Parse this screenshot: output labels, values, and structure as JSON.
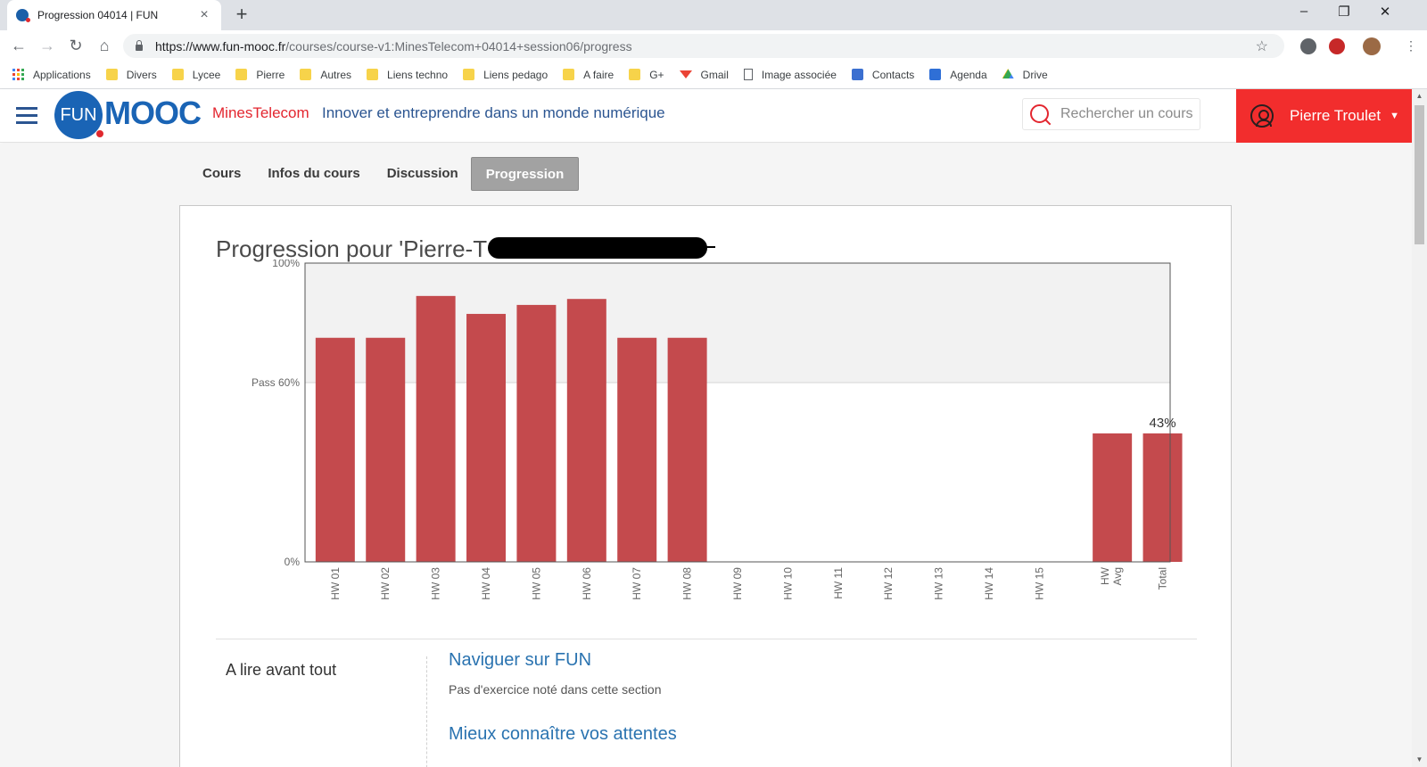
{
  "browser": {
    "tab_title": "Progression 04014 | FUN",
    "tab_close": "×",
    "new_tab": "+",
    "url_host": "https://www.fun-mooc.fr",
    "url_path": "/courses/course-v1:MinesTelecom+04014+session06/progress",
    "win_minimize": "–",
    "win_restore": "❐",
    "win_close": "✕",
    "nav_back": "←",
    "nav_forward": "→",
    "nav_reload": "↻",
    "nav_home": "⌂",
    "star": "☆",
    "bookmarks": [
      {
        "label": "Applications",
        "icon": "apps-grid-icon"
      },
      {
        "label": "Divers",
        "icon": "folder-icon"
      },
      {
        "label": "Lycee",
        "icon": "folder-icon"
      },
      {
        "label": "Pierre",
        "icon": "folder-icon"
      },
      {
        "label": "Autres",
        "icon": "folder-icon"
      },
      {
        "label": "Liens techno",
        "icon": "folder-icon"
      },
      {
        "label": "Liens pedago",
        "icon": "folder-icon"
      },
      {
        "label": "A faire",
        "icon": "folder-icon"
      },
      {
        "label": "G+",
        "icon": "folder-icon"
      },
      {
        "label": "Gmail",
        "icon": "gmail-icon"
      },
      {
        "label": "Image associée",
        "icon": "page-icon"
      },
      {
        "label": "Contacts",
        "icon": "contacts-icon"
      },
      {
        "label": "Agenda",
        "icon": "calendar-icon"
      },
      {
        "label": "Drive",
        "icon": "drive-icon"
      }
    ]
  },
  "site": {
    "logo_fun": "FUN",
    "logo_mooc": "MOOC",
    "org": "MinesTelecom",
    "course_title": "Innover et entreprendre dans un monde numérique",
    "search_placeholder": "Rechercher un cours",
    "user_name": "Pierre Troulet",
    "user_caret": "▼",
    "colors": {
      "brand_blue": "#1a64b5",
      "brand_red": "#f22d2d",
      "bar_red": "#c44a4d"
    }
  },
  "course_nav": {
    "items": [
      "Cours",
      "Infos du cours",
      "Discussion",
      "Progression"
    ],
    "active": "Progression"
  },
  "progress": {
    "title": "Progression pour 'Pierre-T"
  },
  "chart_data": {
    "type": "bar",
    "categories": [
      "HW 01",
      "HW 02",
      "HW 03",
      "HW 04",
      "HW 05",
      "HW 06",
      "HW 07",
      "HW 08",
      "HW 09",
      "HW 10",
      "HW 11",
      "HW 12",
      "HW 13",
      "HW 14",
      "HW 15",
      "HW Avg",
      "Total"
    ],
    "values": [
      75,
      75,
      89,
      83,
      86,
      88,
      75,
      75,
      0,
      0,
      0,
      0,
      0,
      0,
      0,
      43,
      43
    ],
    "y_ticks": [
      "100%",
      "Pass 60%",
      "0%"
    ],
    "y_tick_values": [
      100,
      60,
      0
    ],
    "ylim": [
      0,
      100
    ],
    "pass_threshold": 60,
    "data_labels": [
      {
        "category": "Total",
        "label": "43%"
      }
    ],
    "colors": {
      "bar": "#c44a4d",
      "pass_region": "#f2f2f2",
      "frame": "#555555"
    }
  },
  "sections": [
    {
      "left_label": "A lire avant tout",
      "subsections": [
        {
          "title": "Naviguer sur FUN",
          "note": "Pas d'exercice noté dans cette section"
        },
        {
          "title": "Mieux connaître vos attentes",
          "note": ""
        }
      ]
    }
  ],
  "scrollbar": {
    "up": "▲",
    "down": "▼"
  }
}
